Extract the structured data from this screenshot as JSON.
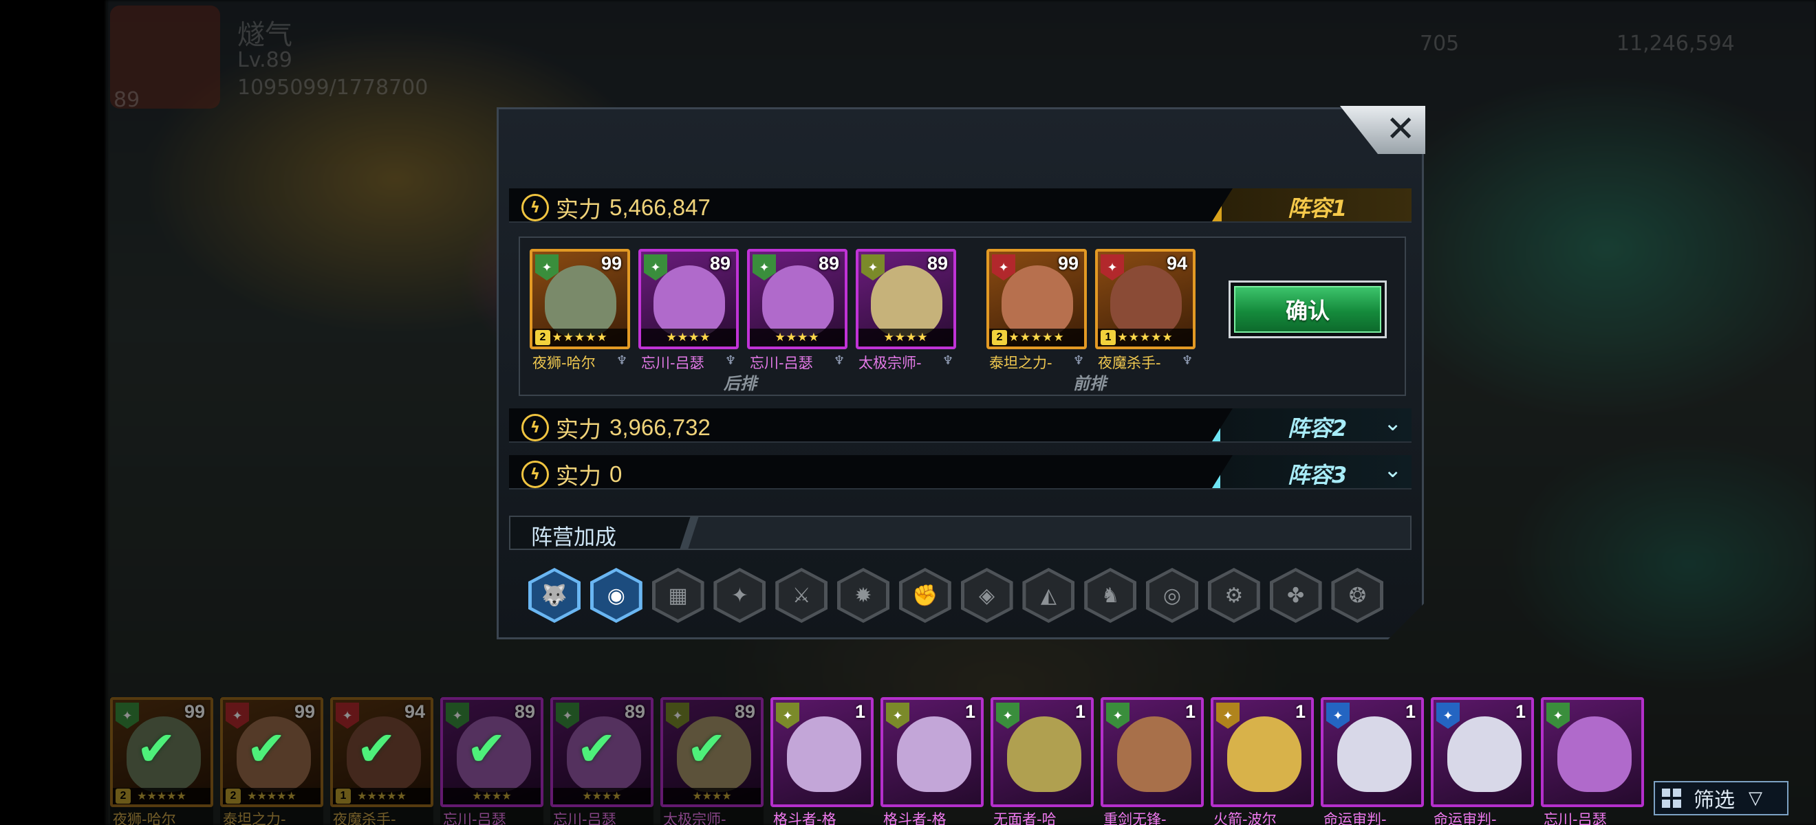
{
  "background": {
    "player_name": "燧气",
    "player_level": "Lv.89",
    "exp": "1095099/1778700",
    "currency_a": "705",
    "currency_b": "11,246,594",
    "avatar_level": "89"
  },
  "dialog": {
    "close_label": "✕",
    "teams": [
      {
        "power_label": "实力",
        "power": "5,466,847",
        "tab_label": "阵容1",
        "expanded": true
      },
      {
        "power_label": "实力",
        "power": "3,966,732",
        "tab_label": "阵容2",
        "expanded": false
      },
      {
        "power_label": "实力",
        "power": "0",
        "tab_label": "阵容3",
        "expanded": false
      }
    ],
    "back_row_label": "后排",
    "front_row_label": "前排",
    "lineup": [
      {
        "name": "夜狮-哈尔",
        "level": "99",
        "rarity": "orange",
        "faction": "green",
        "stars": "★★★★★",
        "rank": "2",
        "portrait": "#7a8a6a"
      },
      {
        "name": "忘川-吕瑟",
        "level": "89",
        "rarity": "purple",
        "faction": "green",
        "stars": "★★★★",
        "rank": "",
        "portrait": "#b06acb"
      },
      {
        "name": "忘川-吕瑟",
        "level": "89",
        "rarity": "purple",
        "faction": "green",
        "stars": "★★★★",
        "rank": "",
        "portrait": "#b06acb"
      },
      {
        "name": "太极宗师-",
        "level": "89",
        "rarity": "purple",
        "faction": "olive",
        "stars": "★★★★",
        "rank": "",
        "portrait": "#c6b27a"
      },
      {
        "name": "泰坦之力-",
        "level": "99",
        "rarity": "orange",
        "faction": "red",
        "stars": "★★★★★",
        "rank": "2",
        "portrait": "#b7704e"
      },
      {
        "name": "夜魔杀手-",
        "level": "94",
        "rarity": "orange",
        "faction": "red",
        "stars": "★★★★★",
        "rank": "1",
        "portrait": "#8a4b36"
      }
    ],
    "confirm_label": "确认",
    "faction_bonus_label": "阵营加成",
    "faction_icons": [
      {
        "icon": "wolf-icon",
        "glyph": "🐺",
        "active": true
      },
      {
        "icon": "spirit-icon",
        "glyph": "◉",
        "active": true
      },
      {
        "icon": "drum-icon",
        "glyph": "▦",
        "active": false
      },
      {
        "icon": "beast-icon",
        "glyph": "✦",
        "active": false
      },
      {
        "icon": "blade-icon",
        "glyph": "⚔",
        "active": false
      },
      {
        "icon": "sunburst-icon",
        "glyph": "✹",
        "active": false
      },
      {
        "icon": "fist-icon",
        "glyph": "✊",
        "active": false
      },
      {
        "icon": "cube-icon",
        "glyph": "◈",
        "active": false
      },
      {
        "icon": "shard-icon",
        "glyph": "◭",
        "active": false
      },
      {
        "icon": "warrior-icon",
        "glyph": "♞",
        "active": false
      },
      {
        "icon": "spiral-icon",
        "glyph": "◎",
        "active": false
      },
      {
        "icon": "gear-icon",
        "glyph": "⚙",
        "active": false
      },
      {
        "icon": "claw-icon",
        "glyph": "✤",
        "active": false
      },
      {
        "icon": "dragon-icon",
        "glyph": "❂",
        "active": false
      }
    ]
  },
  "roster": [
    {
      "name": "夜狮-哈尔",
      "level": "99",
      "rarity": "orange",
      "faction": "green",
      "rank": "2",
      "stars": "★★★★★",
      "selected": true,
      "portrait": "#6b7a5a"
    },
    {
      "name": "泰坦之力-",
      "level": "99",
      "rarity": "orange",
      "faction": "red",
      "rank": "2",
      "stars": "★★★★★",
      "selected": true,
      "portrait": "#9a6a4a"
    },
    {
      "name": "夜魔杀手-",
      "level": "94",
      "rarity": "orange",
      "faction": "red",
      "rank": "1",
      "stars": "★★★★★",
      "selected": true,
      "portrait": "#7a4a36"
    },
    {
      "name": "忘川-吕瑟",
      "level": "89",
      "rarity": "purple",
      "faction": "green",
      "rank": "",
      "stars": "★★★★",
      "selected": true,
      "portrait": "#9a5aab"
    },
    {
      "name": "忘川-吕瑟",
      "level": "89",
      "rarity": "purple",
      "faction": "green",
      "rank": "",
      "stars": "★★★★",
      "selected": true,
      "portrait": "#9a5aab"
    },
    {
      "name": "太极宗师-",
      "level": "89",
      "rarity": "purple",
      "faction": "olive",
      "rank": "",
      "stars": "★★★★",
      "selected": true,
      "portrait": "#a8966a"
    },
    {
      "name": "格斗者-格",
      "level": "1",
      "rarity": "purple",
      "faction": "olive",
      "rank": "",
      "stars": "",
      "selected": false,
      "portrait": "#c3a6d8"
    },
    {
      "name": "格斗者-格",
      "level": "1",
      "rarity": "purple",
      "faction": "olive",
      "rank": "",
      "stars": "",
      "selected": false,
      "portrait": "#c3a6d8"
    },
    {
      "name": "无面者-哈",
      "level": "1",
      "rarity": "purple",
      "faction": "green",
      "rank": "",
      "stars": "",
      "selected": false,
      "portrait": "#b0a050"
    },
    {
      "name": "重剑无锋-",
      "level": "1",
      "rarity": "purple",
      "faction": "green",
      "rank": "",
      "stars": "",
      "selected": false,
      "portrait": "#a8704a"
    },
    {
      "name": "火箭-波尔",
      "level": "1",
      "rarity": "purple",
      "faction": "gold",
      "rank": "",
      "stars": "",
      "selected": false,
      "portrait": "#d8b24a"
    },
    {
      "name": "命运审判-",
      "level": "1",
      "rarity": "purple",
      "faction": "blue",
      "rank": "",
      "stars": "",
      "selected": false,
      "portrait": "#d8d8e8"
    },
    {
      "name": "命运审判-",
      "level": "1",
      "rarity": "purple",
      "faction": "blue",
      "rank": "",
      "stars": "",
      "selected": false,
      "portrait": "#d8d8e8"
    },
    {
      "name": "忘川-吕瑟",
      "level": "",
      "rarity": "purple",
      "faction": "green",
      "rank": "",
      "stars": "",
      "selected": false,
      "portrait": "#b06acb"
    }
  ],
  "filter": {
    "label": "筛选",
    "arrow": "▽"
  }
}
